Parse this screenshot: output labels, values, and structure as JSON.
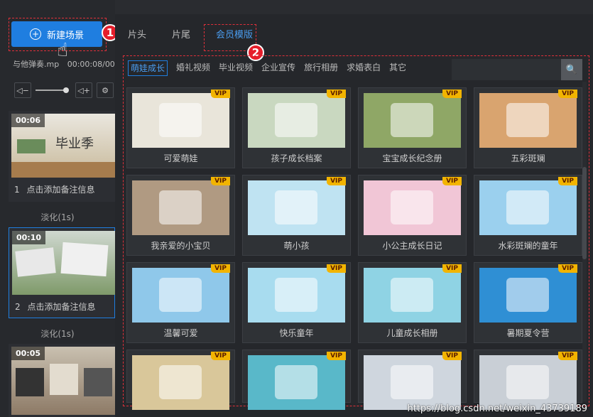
{
  "sidebar": {
    "new_scene_label": "新建场景",
    "file_name": "与他弹奏.mp",
    "file_time": "00:00:08/00",
    "scenes": [
      {
        "time": "00:06",
        "index": "1",
        "note": "点击添加备注信息",
        "thumb_text": "毕业季",
        "selected": false
      },
      {
        "time": "00:10",
        "index": "2",
        "note": "点击添加备注信息",
        "thumb_text": "",
        "selected": true
      },
      {
        "time": "00:05",
        "index": "",
        "note": "",
        "thumb_text": "",
        "selected": false
      }
    ],
    "transitions": [
      "淡化(1s)",
      "淡化(1s)"
    ]
  },
  "badges": {
    "first": "1",
    "second": "2"
  },
  "tabs": [
    {
      "label": "片头",
      "active": false
    },
    {
      "label": "片尾",
      "active": false
    },
    {
      "label": "会员模版",
      "active": true
    }
  ],
  "categories": [
    {
      "label": "萌娃成长",
      "active": true
    },
    {
      "label": "婚礼视频",
      "active": false
    },
    {
      "label": "毕业视频",
      "active": false
    },
    {
      "label": "企业宣传",
      "active": false
    },
    {
      "label": "旅行相册",
      "active": false
    },
    {
      "label": "求婚表白",
      "active": false
    },
    {
      "label": "其它",
      "active": false
    }
  ],
  "vip_label": "VIP",
  "templates": [
    {
      "title": "可爱萌娃",
      "bg": "#e9e5da"
    },
    {
      "title": "孩子成长档案",
      "bg": "#c9d8c0"
    },
    {
      "title": "宝宝成长纪念册",
      "bg": "#8fa766"
    },
    {
      "title": "五彩斑斓",
      "bg": "#d9a46f"
    },
    {
      "title": "我亲爱的小宝贝",
      "bg": "#b09a82"
    },
    {
      "title": "萌小孩",
      "bg": "#bfe3f2"
    },
    {
      "title": "小公主成长日记",
      "bg": "#f1c6d6"
    },
    {
      "title": "水彩斑斓的童年",
      "bg": "#9bd0ee"
    },
    {
      "title": "温馨可爱",
      "bg": "#8fc8ea"
    },
    {
      "title": "快乐童年",
      "bg": "#a8dcef"
    },
    {
      "title": "儿童成长相册",
      "bg": "#8fd3e4"
    },
    {
      "title": "暑期夏令营",
      "bg": "#2f8fd4"
    },
    {
      "title": "",
      "bg": "#d9c79a"
    },
    {
      "title": "",
      "bg": "#59b8c9"
    },
    {
      "title": "",
      "bg": "#cfd6de"
    },
    {
      "title": "",
      "bg": "#c9cfd6"
    }
  ],
  "watermark": "https://blog.csdn.net/weixin_43739189"
}
